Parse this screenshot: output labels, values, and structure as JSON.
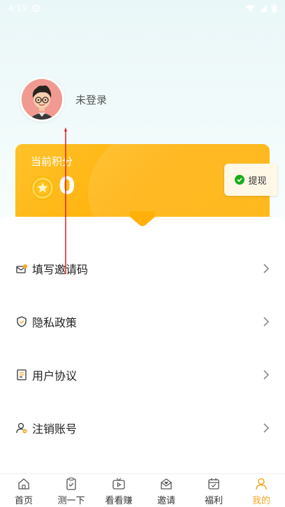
{
  "status_bar": {
    "time": "4:19"
  },
  "profile": {
    "login_status": "未登录"
  },
  "points_card": {
    "label": "当前积分",
    "value": "0",
    "withdraw_label": "提现"
  },
  "menu": {
    "items": [
      {
        "label": "填写邀请码",
        "icon": "envelope-icon"
      },
      {
        "label": "隐私政策",
        "icon": "shield-icon"
      },
      {
        "label": "用户协议",
        "icon": "document-icon"
      },
      {
        "label": "注销账号",
        "icon": "user-cancel-icon"
      }
    ]
  },
  "bottom_nav": {
    "items": [
      {
        "label": "首页",
        "icon": "home-icon"
      },
      {
        "label": "测一下",
        "icon": "clipboard-check-icon"
      },
      {
        "label": "看看赚",
        "icon": "tv-play-icon"
      },
      {
        "label": "邀请",
        "icon": "invite-envelope-icon"
      },
      {
        "label": "福利",
        "icon": "calendar-gift-icon"
      },
      {
        "label": "我的",
        "icon": "user-icon"
      }
    ],
    "active_index": 5
  },
  "colors": {
    "accent": "#f5a623",
    "card": "#ffb10a",
    "guide_arrow": "#e02020"
  }
}
